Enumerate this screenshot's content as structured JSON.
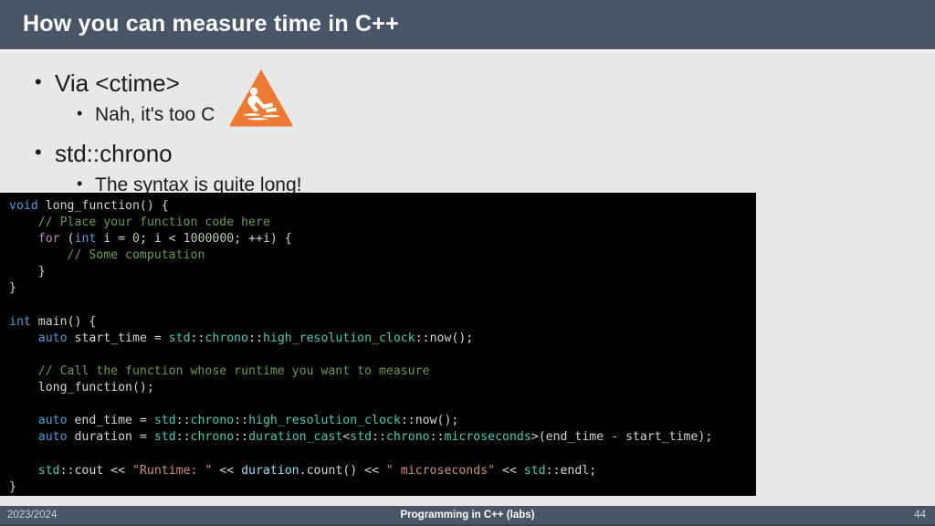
{
  "slide": {
    "title": "How you can measure time in C++",
    "accent_header_color": "#485668",
    "background_color": "#e8e8e8",
    "warning_icon_color": "#ec7a32"
  },
  "bullets": [
    {
      "level": 1,
      "text": "Via <ctime>"
    },
    {
      "level": 2,
      "text": "Nah, it's too C"
    },
    {
      "level": 1,
      "text": "std::chrono"
    },
    {
      "level": 2,
      "text": "The syntax is quite long!"
    }
  ],
  "icons": {
    "warning_slip_hazard": "slippery-floor-warning-triangle"
  },
  "code": {
    "language": "cpp",
    "background": "#000000",
    "lines": [
      "void long_function() {",
      "    // Place your function code here",
      "    for (int i = 0; i < 1000000; ++i) {",
      "        // Some computation",
      "    }",
      "}",
      "",
      "int main() {",
      "    auto start_time = std::chrono::high_resolution_clock::now();",
      "",
      "    // Call the function whose runtime you want to measure",
      "    long_function();",
      "",
      "    auto end_time = std::chrono::high_resolution_clock::now();",
      "    auto duration = std::chrono::duration_cast<std::chrono::microseconds>(end_time - start_time);",
      "",
      "    std::cout << \"Runtime: \" << duration.count() << \" microseconds\" << std::endl;",
      "}"
    ],
    "colors": {
      "keyword": "#569cd6",
      "control": "#c586c0",
      "comment": "#6a9955",
      "type": "#4ec9b0",
      "number": "#b5cea8",
      "string": "#ce9178",
      "variable": "#9cdcfe",
      "plain": "#d4d4d4"
    }
  },
  "footer": {
    "left": "2023/2024",
    "center": "Programming in C++ (labs)",
    "right": "44"
  }
}
